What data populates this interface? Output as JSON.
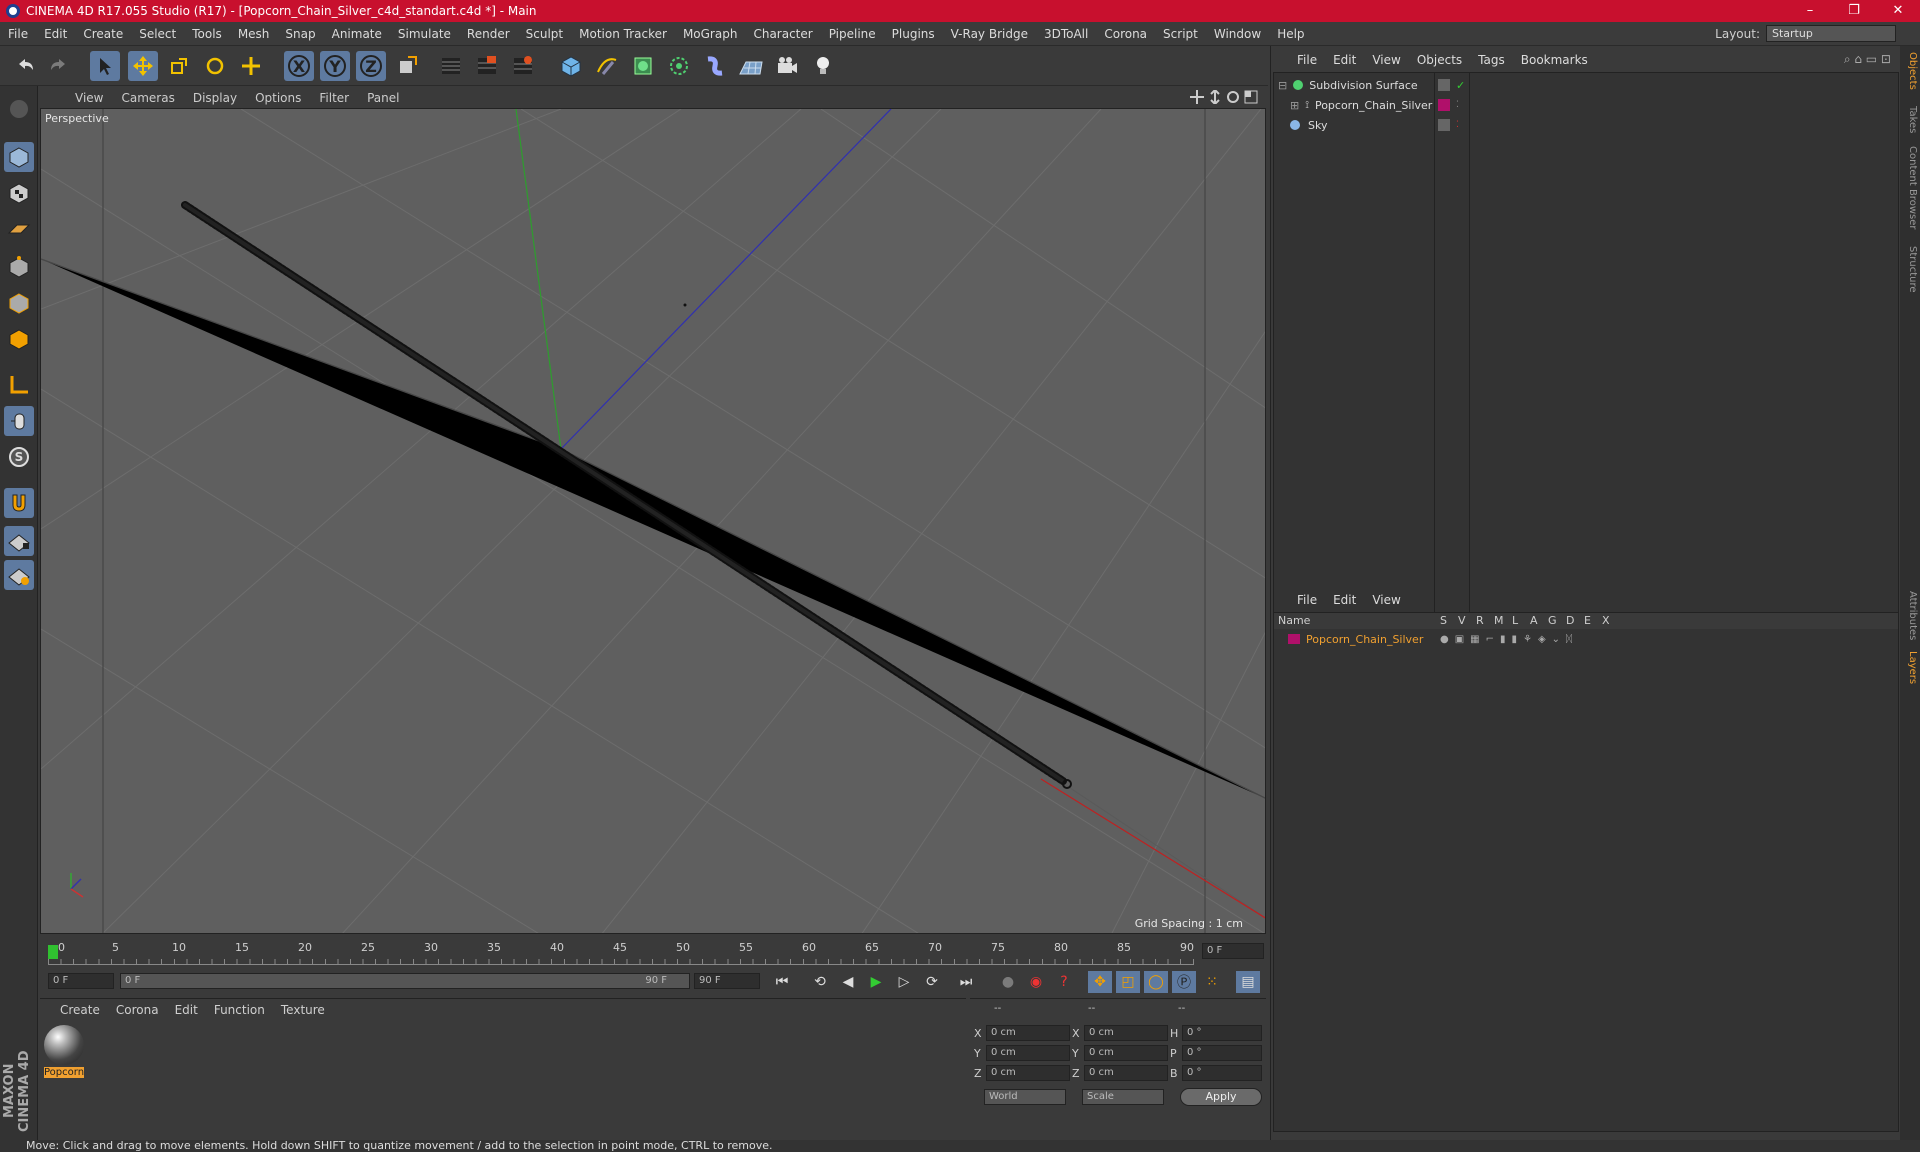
{
  "title": "CINEMA 4D R17.055 Studio (R17) - [Popcorn_Chain_Silver_c4d_standart.c4d *] - Main",
  "window_controls": {
    "minimize": "–",
    "maximize": "❐",
    "close": "✕"
  },
  "menu": [
    "File",
    "Edit",
    "Create",
    "Select",
    "Tools",
    "Mesh",
    "Snap",
    "Animate",
    "Simulate",
    "Render",
    "Sculpt",
    "Motion Tracker",
    "MoGraph",
    "Character",
    "Pipeline",
    "Plugins",
    "V-Ray Bridge",
    "3DToAll",
    "Corona",
    "Script",
    "Window",
    "Help"
  ],
  "layout": {
    "label": "Layout:",
    "value": "Startup"
  },
  "toolbar": {
    "x": "X",
    "y": "Y",
    "z": "Z"
  },
  "viewport": {
    "menu": [
      "View",
      "Cameras",
      "Display",
      "Options",
      "Filter",
      "Panel"
    ],
    "label": "Perspective",
    "grid_spacing": "Grid Spacing : 1 cm"
  },
  "timeline": {
    "ticks": [
      "0",
      "5",
      "10",
      "15",
      "20",
      "25",
      "30",
      "35",
      "40",
      "45",
      "50",
      "55",
      "60",
      "65",
      "70",
      "75",
      "80",
      "85",
      "90"
    ],
    "current_frame": "0 F"
  },
  "playback": {
    "start": "0 F",
    "range_start": "0 F",
    "range_end": "90 F",
    "end": "90 F"
  },
  "material_panel": {
    "menu": [
      "Create",
      "Corona",
      "Edit",
      "Function",
      "Texture"
    ],
    "material_name": "Popcorn"
  },
  "coords": {
    "headers": [
      "--",
      "--",
      "--"
    ],
    "rows": [
      {
        "a": "X",
        "av": "0 cm",
        "b": "X",
        "bv": "0 cm",
        "c": "H",
        "cv": "0 °"
      },
      {
        "a": "Y",
        "av": "0 cm",
        "b": "Y",
        "bv": "0 cm",
        "c": "P",
        "cv": "0 °"
      },
      {
        "a": "Z",
        "av": "0 cm",
        "b": "Z",
        "bv": "0 cm",
        "c": "B",
        "cv": "0 °"
      }
    ],
    "mode1": "World",
    "mode2": "Scale",
    "apply": "Apply"
  },
  "objects": {
    "menu": [
      "File",
      "Edit",
      "View",
      "Objects",
      "Tags",
      "Bookmarks"
    ],
    "items": [
      {
        "name": "Subdivision Surface"
      },
      {
        "name": "Popcorn_Chain_Silver"
      },
      {
        "name": "Sky"
      }
    ]
  },
  "layers": {
    "menu": [
      "File",
      "Edit",
      "View"
    ],
    "columns": [
      "Name",
      "S",
      "V",
      "R",
      "M",
      "L",
      "A",
      "G",
      "D",
      "E",
      "X"
    ],
    "items": [
      {
        "name": "Popcorn_Chain_Silver"
      }
    ]
  },
  "side_tabs": [
    "Objects",
    "Takes",
    "Content Browser",
    "Structure",
    "Attributes",
    "Layers"
  ],
  "brand": "MAXON CINEMA 4D",
  "status": "Move: Click and drag to move elements. Hold down SHIFT to quantize movement / add to the selection in point mode, CTRL to remove.",
  "colors": {
    "title_bg": "#c8102e",
    "accent": "#5e7aa0",
    "layer_color": "#b0106a",
    "layer_text": "#f0a030"
  }
}
